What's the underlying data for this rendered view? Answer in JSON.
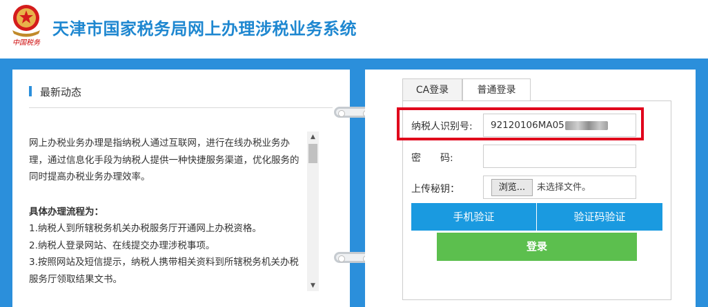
{
  "header": {
    "title": "天津市国家税务局网上办理涉税业务系统",
    "emblem_caption": "中国税务"
  },
  "news": {
    "title": "最新动态",
    "intro": "网上办税业务办理是指纳税人通过互联网，进行在线办税业务办理，通过信息化手段为纳税人提供一种快捷服务渠道，优化服务的同时提高办税业务办理效率。",
    "steps_title": "具体办理流程为：",
    "steps": [
      "1.纳税人到所辖税务机关办税服务厅开通网上办税资格。",
      "2.纳税人登录网站、在线提交办理涉税事项。",
      "3.按照网站及短信提示，纳税人携带相关资料到所辖税务机关办税服务厅领取结果文书。"
    ]
  },
  "login": {
    "tabs": [
      {
        "label": "CA登录",
        "active": false
      },
      {
        "label": "普通登录",
        "active": true
      }
    ],
    "taxpayer_id_label": "纳税人识别号:",
    "taxpayer_id_value": "92120106MA05",
    "password_label": "密　　码:",
    "upload_label": "上传秘钥：",
    "browse_label": "浏览...",
    "no_file_text": "未选择文件。",
    "phone_verify_label": "手机验证",
    "captcha_verify_label": "验证码验证",
    "login_label": "登录"
  },
  "colors": {
    "brand_blue": "#2b8fdb",
    "title_blue": "#1e87d0",
    "button_blue": "#1a9ae0",
    "login_green": "#5cbf4e",
    "highlight_red": "#e0001b"
  }
}
